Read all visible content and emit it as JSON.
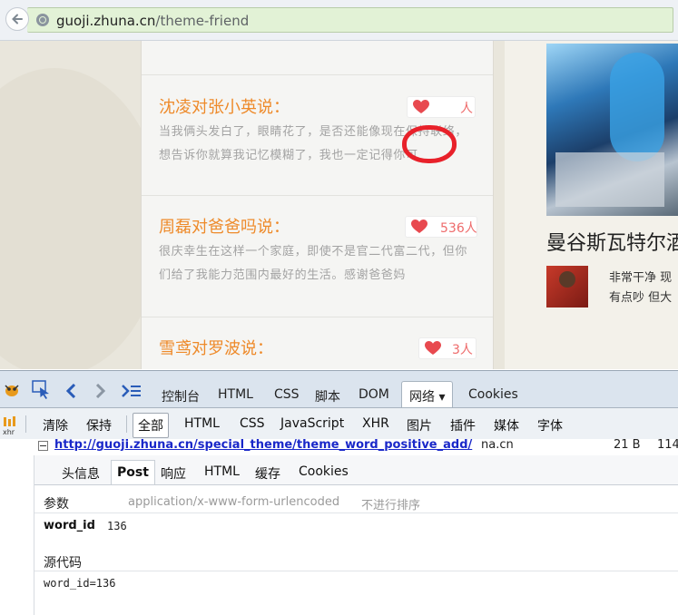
{
  "browser": {
    "url_host": "guoji.zhuna.cn",
    "url_path": "/theme-friend"
  },
  "page": {
    "entries": [
      {
        "title": "沈凌对张小英说：",
        "body": "当我俩头发白了，眼睛花了，是否还能像现在保持联络，想告诉你就算我记忆模糊了，我也一定记得你可",
        "likes": "人",
        "heart_icon": "heart-icon"
      },
      {
        "title": "周磊对爸爸吗说：",
        "body": "很庆幸生在这样一个家庭，即使不是官二代富二代，但你们给了我能力范围内最好的生活。感谢爸爸妈",
        "likes": "536人",
        "heart_icon": "heart-icon"
      },
      {
        "title": "雪鸢对罗波说：",
        "body": "",
        "likes": "3人",
        "heart_icon": "heart-icon"
      }
    ],
    "hotel_title": "曼谷斯瓦特尔酒",
    "comment_lines": [
      "非常干净 现",
      "有点吵 但大"
    ],
    "annotation_color": "#e8212a"
  },
  "devtools": {
    "panels": [
      "控制台",
      "HTML",
      "CSS",
      "脚本",
      "DOM",
      "网络 ▾",
      "Cookies"
    ],
    "active_panel": "网络 ▾",
    "actions": [
      "清除",
      "保持"
    ],
    "filters": [
      "全部",
      "HTML",
      "CSS",
      "JavaScript",
      "XHR",
      "图片",
      "插件",
      "媒体",
      "字体"
    ],
    "active_filter": "全部",
    "request": {
      "url": "http://guoji.zhuna.cn/special_theme/theme_word_positive_add/",
      "domain": "na.cn",
      "size": "21 B",
      "time": "114"
    },
    "detail_tabs": [
      "头信息",
      "Post",
      "响应",
      "HTML",
      "缓存",
      "Cookies"
    ],
    "active_detail_tab": "Post",
    "params_label": "参数",
    "content_type": "application/x-www-form-urlencoded",
    "sort_label": "不进行排序",
    "param_name": "word_id",
    "param_value": "136",
    "source_label": "源代码",
    "source_text": "word_id=136"
  }
}
